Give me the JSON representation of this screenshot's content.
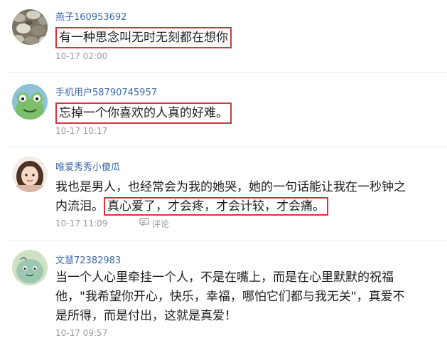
{
  "comments": [
    {
      "username": "燕子160953692",
      "text_highlight": "有一种思念叫无时无刻都在想你",
      "timestamp": "10-17 02:00",
      "avatar_icon": "stones-avatar-icon"
    },
    {
      "username": "手机用户58790745957",
      "text_highlight": "忘掉一个你喜欢的人真的好难。",
      "timestamp": "10-17 10:17",
      "avatar_icon": "frog-avatar-icon"
    },
    {
      "username": "唯爱秀秀小傻瓜",
      "text_line1": "我也是男人，也经常会为我的她哭，她的一句话能让我在一秒钟之",
      "text_line2_plain": "内流泪。",
      "text_highlight": "真心爱了，才会疼，才会计较，才会痛。",
      "timestamp": "10-17 11:09",
      "reply_label": "评论",
      "avatar_icon": "girl-avatar-icon"
    },
    {
      "username": "文慧72382983",
      "text_line1": "当一个人心里牵挂一个人，不是在嘴上，而是在心里默默的祝福",
      "text_line2": "他，\"我希望你开心，快乐，幸福，哪怕它们都与我无关\"，真爱不",
      "text_line3": "是所得，而是付出，这就是真爱！",
      "timestamp": "10-17 09:57",
      "avatar_icon": "cartoon-avatar-icon"
    }
  ],
  "colors": {
    "username": "#3a67a8",
    "timestamp": "#9a9a9a",
    "highlight_border": "#d9333f",
    "divider": "#ececec"
  }
}
